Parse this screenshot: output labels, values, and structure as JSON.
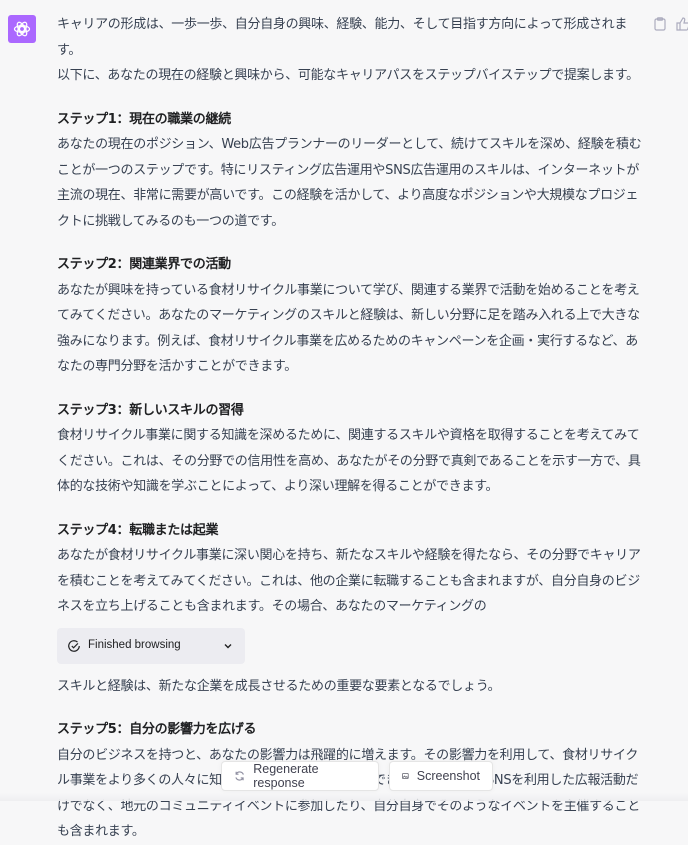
{
  "message": {
    "intro": [
      "キャリアの形成は、一歩一歩、自分自身の興味、経験、能力、そして目指す方向によって形成されます。",
      "以下に、あなたの現在の経験と興味から、可能なキャリアパスをステップバイステップで提案します。"
    ],
    "steps": [
      {
        "title": "ステップ1：現在の職業の継続",
        "body": "あなたの現在のポジション、Web広告プランナーのリーダーとして、続けてスキルを深め、経験を積むことが一つのステップです。特にリスティング広告運用やSNS広告運用のスキルは、インターネットが主流の現在、非常に需要が高いです。この経験を活かして、より高度なポジションや大規模なプロジェクトに挑戦してみるのも一つの道です。"
      },
      {
        "title": "ステップ2：関連業界での活動",
        "body": "あなたが興味を持っている食材リサイクル事業について学び、関連する業界で活動を始めることを考えてみてください。あなたのマーケティングのスキルと経験は、新しい分野に足を踏み入れる上で大きな強みになります。例えば、食材リサイクル事業を広めるためのキャンペーンを企画・実行するなど、あなたの専門分野を活かすことができます。"
      },
      {
        "title": "ステップ3：新しいスキルの習得",
        "body": "食材リサイクル事業に関する知識を深めるために、関連するスキルや資格を取得することを考えてみてください。これは、その分野での信用性を高め、あなたがその分野で真剣であることを示す一方で、具体的な技術や知識を学ぶことによって、より深い理解を得ることができます。"
      },
      {
        "title": "ステップ4：転職または起業",
        "body": "あなたが食材リサイクル事業に深い関心を持ち、新たなスキルや経験を得たなら、その分野でキャリアを積むことを考えてみてください。これは、他の企業に転職することも含まれますが、自分自身のビジネスを立ち上げることも含まれます。その場合、あなたのマーケティングの",
        "body_after_browse": "スキルと経験は、新たな企業を成長させるための重要な要素となるでしょう。"
      },
      {
        "title": "ステップ5：自分の影響力を広げる",
        "body": "自分のビジネスを持つと、あなたの影響力は飛躍的に増えます。その影響力を利用して、食材リサイクル事業をより多くの人々に知ってもらい、広めることができます。これは、SNSを利用した広報活動だけでなく、地元のコミュニティイベントに参加したり、自分自身でそのようなイベントを主催することも含まれます。"
      }
    ],
    "browse_status": "Finished browsing"
  },
  "message_actions": {
    "copy_icon": "clipboard-icon",
    "thumbs_up_icon": "thumbs-up-icon"
  },
  "bottom_buttons": {
    "regenerate_label": "Regenerate response",
    "screenshot_label": "Screenshot"
  },
  "colors": {
    "assistant_avatar": "#ab68ff",
    "background": "#f7f7f8"
  }
}
